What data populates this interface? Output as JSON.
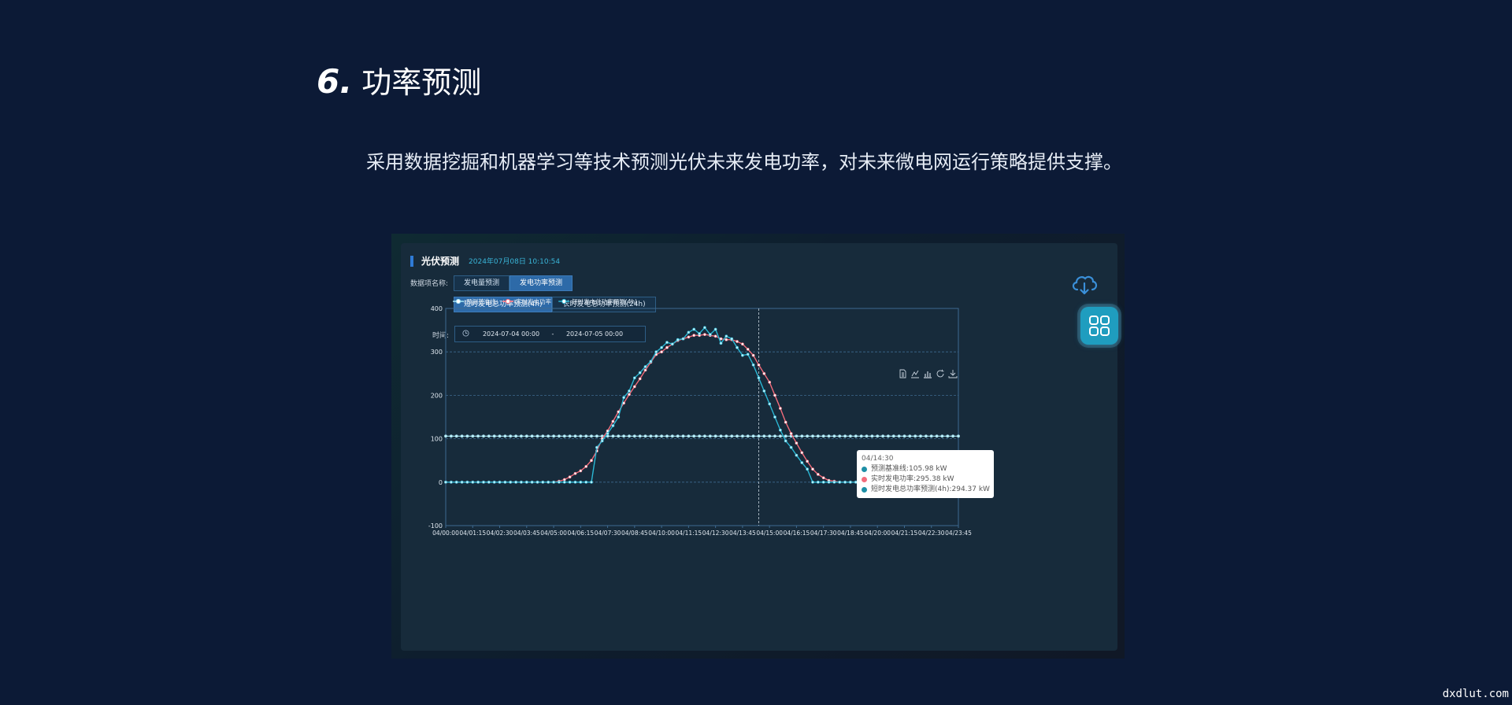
{
  "slide": {
    "number": "6.",
    "title": "功率预测",
    "description": "采用数据挖掘和机器学习等技术预测光伏未来发电功率，对未来微电网运行策略提供支撑。",
    "watermark": "dxdlut.com"
  },
  "panel": {
    "title": "光伏预测",
    "datetime": "2024年07月08日 10:10:54",
    "data_item_label": "数据项名称:",
    "data_item_buttons": [
      {
        "label": "发电量预测",
        "active": false
      },
      {
        "label": "发电功率预测",
        "active": true
      }
    ],
    "mode_buttons": [
      {
        "label": "短时发电总功率预测(4h)",
        "active": true
      },
      {
        "label": "长时发电总功率预测(24h)",
        "active": false
      }
    ],
    "time_label": "时间:",
    "start_date": "2024-07-04 00:00",
    "range_separator": "-",
    "end_date": "2024-07-05 00:00",
    "icons": {
      "download": "cloud-download-icon",
      "menu": "grid-menu-icon",
      "clock": "clock-icon"
    }
  },
  "chart_data": {
    "type": "line",
    "ylim": [
      -100,
      400
    ],
    "yticks": [
      "400",
      "300",
      "200",
      "100",
      "0",
      "-100"
    ],
    "x": [
      "04/00:00",
      "04/00:15",
      "04/00:30",
      "04/00:45",
      "04/01:00",
      "04/01:15",
      "04/01:30",
      "04/01:45",
      "04/02:00",
      "04/02:15",
      "04/02:30",
      "04/02:45",
      "04/03:00",
      "04/03:15",
      "04/03:30",
      "04/03:45",
      "04/04:00",
      "04/04:15",
      "04/04:30",
      "04/04:45",
      "04/05:00",
      "04/05:15",
      "04/05:30",
      "04/05:45",
      "04/06:00",
      "04/06:15",
      "04/06:30",
      "04/06:45",
      "04/07:00",
      "04/07:15",
      "04/07:30",
      "04/07:45",
      "04/08:00",
      "04/08:15",
      "04/08:30",
      "04/08:45",
      "04/09:00",
      "04/09:15",
      "04/09:30",
      "04/09:45",
      "04/10:00",
      "04/10:15",
      "04/10:30",
      "04/10:45",
      "04/11:00",
      "04/11:15",
      "04/11:30",
      "04/11:45",
      "04/12:00",
      "04/12:15",
      "04/12:30",
      "04/12:45",
      "04/13:00",
      "04/13:15",
      "04/13:30",
      "04/13:45",
      "04/14:00",
      "04/14:15",
      "04/14:30",
      "04/14:45",
      "04/15:00",
      "04/15:15",
      "04/15:30",
      "04/15:45",
      "04/16:00",
      "04/16:15",
      "04/16:30",
      "04/16:45",
      "04/17:00",
      "04/17:15",
      "04/17:30",
      "04/17:45",
      "04/18:00",
      "04/18:15",
      "04/18:30",
      "04/18:45",
      "04/19:00",
      "04/19:15",
      "04/19:30",
      "04/19:45",
      "04/20:00",
      "04/20:15",
      "04/20:30",
      "04/20:45",
      "04/21:00",
      "04/21:15",
      "04/21:30",
      "04/21:45",
      "04/22:00",
      "04/22:15",
      "04/22:30",
      "04/22:45",
      "04/23:00",
      "04/23:15",
      "04/23:30",
      "04/23:45"
    ],
    "xticks": [
      "04/00:00",
      "04/01:15",
      "04/02:30",
      "04/03:45",
      "04/05:00",
      "04/06:15",
      "04/07:30",
      "04/08:45",
      "04/10:00",
      "04/11:15",
      "04/12:30",
      "04/13:45",
      "04/15:00",
      "04/16:15",
      "04/17:30",
      "04/18:45",
      "04/20:00",
      "04/21:15",
      "04/22:30",
      "04/23:45"
    ],
    "series": [
      {
        "name": "预测基准线",
        "color": "#a8e6f5",
        "values": [
          105.98,
          105.98,
          105.98,
          105.98,
          105.98,
          105.98,
          105.98,
          105.98,
          105.98,
          105.98,
          105.98,
          105.98,
          105.98,
          105.98,
          105.98,
          105.98,
          105.98,
          105.98,
          105.98,
          105.98,
          105.98,
          105.98,
          105.98,
          105.98,
          105.98,
          105.98,
          105.98,
          105.98,
          105.98,
          105.98,
          105.98,
          105.98,
          105.98,
          105.98,
          105.98,
          105.98,
          105.98,
          105.98,
          105.98,
          105.98,
          105.98,
          105.98,
          105.98,
          105.98,
          105.98,
          105.98,
          105.98,
          105.98,
          105.98,
          105.98,
          105.98,
          105.98,
          105.98,
          105.98,
          105.98,
          105.98,
          105.98,
          105.98,
          105.98,
          105.98,
          105.98,
          105.98,
          105.98,
          105.98,
          105.98,
          105.98,
          105.98,
          105.98,
          105.98,
          105.98,
          105.98,
          105.98,
          105.98,
          105.98,
          105.98,
          105.98,
          105.98,
          105.98,
          105.98,
          105.98,
          105.98,
          105.98,
          105.98,
          105.98,
          105.98,
          105.98,
          105.98,
          105.98,
          105.98,
          105.98,
          105.98,
          105.98,
          105.98,
          105.98,
          105.98,
          105.98
        ]
      },
      {
        "name": "实时发电功率",
        "color": "#f36c7b",
        "values": [
          0,
          0,
          0,
          0,
          0,
          0,
          0,
          0,
          0,
          0,
          0,
          0,
          0,
          0,
          0,
          0,
          0,
          0,
          0,
          0,
          0,
          2,
          6,
          12,
          20,
          26,
          36,
          50,
          72,
          100,
          118,
          140,
          162,
          182,
          202,
          220,
          238,
          258,
          276,
          294,
          300,
          310,
          318,
          326,
          330,
          334,
          338,
          338,
          340,
          338,
          336,
          330,
          328,
          328,
          324,
          318,
          306,
          292,
          270,
          250,
          230,
          200,
          170,
          138,
          112,
          90,
          68,
          48,
          30,
          18,
          10,
          4,
          2,
          0,
          0,
          0,
          0,
          0,
          0,
          0,
          0,
          0,
          0,
          0,
          0,
          0,
          0,
          0,
          0,
          0,
          0,
          0,
          0,
          0,
          0,
          0
        ]
      },
      {
        "name": "短时发电总功率预测(4h)",
        "color": "#2bb7d4",
        "values": [
          0,
          0,
          0,
          0,
          0,
          0,
          0,
          0,
          0,
          0,
          0,
          0,
          0,
          0,
          0,
          0,
          0,
          0,
          0,
          0,
          0,
          0,
          0,
          0,
          0,
          0,
          0,
          0,
          80,
          95,
          112,
          130,
          150,
          195,
          210,
          240,
          252,
          266,
          278,
          300,
          310,
          322,
          318,
          328,
          330,
          345,
          352,
          342,
          356,
          340,
          352,
          320,
          336,
          330,
          310,
          292,
          294.37,
          270,
          240,
          210,
          180,
          150,
          120,
          95,
          80,
          62,
          45,
          30,
          0,
          0,
          0,
          0,
          0,
          0,
          0,
          0,
          0,
          0,
          0,
          0,
          0,
          0,
          0,
          0,
          0,
          0,
          0,
          0,
          0,
          0,
          0,
          0,
          0,
          0,
          0,
          0
        ]
      }
    ],
    "tooltip": {
      "time": "04/14:30",
      "rows": [
        {
          "text": "预测基准线:105.98 kW",
          "color": "#1e8fa6"
        },
        {
          "text": "实时发电功率:295.38 kW",
          "color": "#f36c7b"
        },
        {
          "text": "短时发电总功率预测(4h):294.37 kW",
          "color": "#1e8fa6"
        }
      ]
    },
    "cursor_index": 58,
    "grid": true,
    "legend_position": "top-left"
  }
}
